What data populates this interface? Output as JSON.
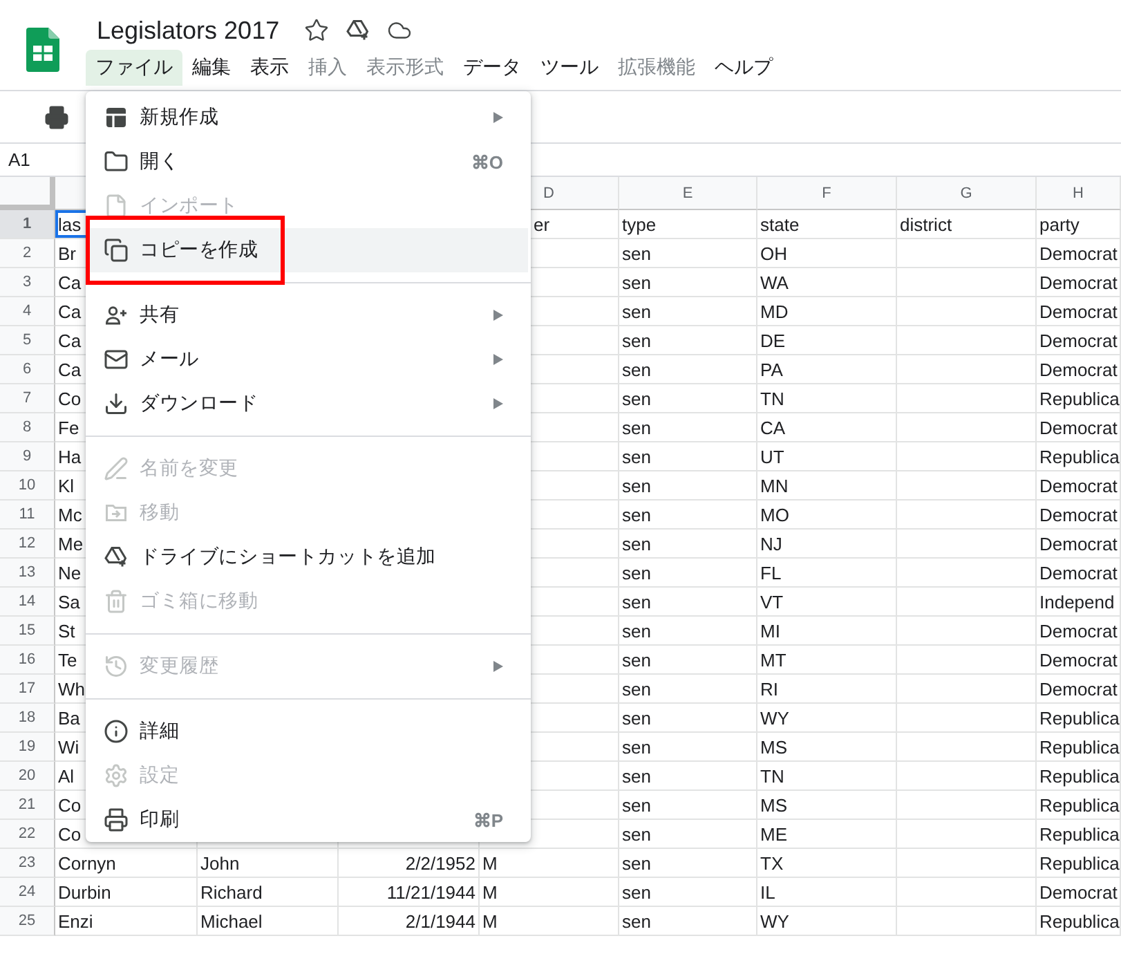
{
  "document": {
    "title": "Legislators 2017"
  },
  "menu_bar": [
    {
      "label": "ファイル",
      "selected": true,
      "disabled": false
    },
    {
      "label": "編集",
      "selected": false,
      "disabled": false
    },
    {
      "label": "表示",
      "selected": false,
      "disabled": false
    },
    {
      "label": "挿入",
      "selected": false,
      "disabled": true
    },
    {
      "label": "表示形式",
      "selected": false,
      "disabled": true
    },
    {
      "label": "データ",
      "selected": false,
      "disabled": false
    },
    {
      "label": "ツール",
      "selected": false,
      "disabled": false
    },
    {
      "label": "拡張機能",
      "selected": false,
      "disabled": true
    },
    {
      "label": "ヘルプ",
      "selected": false,
      "disabled": false
    }
  ],
  "name_box": "A1",
  "column_headers": [
    "D",
    "E",
    "F",
    "G",
    "H"
  ],
  "rows": [
    {
      "number": "1",
      "selected": true,
      "cells": {
        "a": "las",
        "d": "er",
        "e": "type",
        "f": "state",
        "g": "district",
        "h": "party"
      }
    },
    {
      "number": "2",
      "selected": false,
      "cells": {
        "a": "Br",
        "e": "sen",
        "f": "OH",
        "h": "Democrat"
      }
    },
    {
      "number": "3",
      "selected": false,
      "cells": {
        "a": "Ca",
        "e": "sen",
        "f": "WA",
        "h": "Democrat"
      }
    },
    {
      "number": "4",
      "selected": false,
      "cells": {
        "a": "Ca",
        "e": "sen",
        "f": "MD",
        "h": "Democrat"
      }
    },
    {
      "number": "5",
      "selected": false,
      "cells": {
        "a": "Ca",
        "e": "sen",
        "f": "DE",
        "h": "Democrat"
      }
    },
    {
      "number": "6",
      "selected": false,
      "cells": {
        "a": "Ca",
        "e": "sen",
        "f": "PA",
        "h": "Democrat"
      }
    },
    {
      "number": "7",
      "selected": false,
      "cells": {
        "a": "Co",
        "e": "sen",
        "f": "TN",
        "h": "Republica"
      }
    },
    {
      "number": "8",
      "selected": false,
      "cells": {
        "a": "Fe",
        "e": "sen",
        "f": "CA",
        "h": "Democrat"
      }
    },
    {
      "number": "9",
      "selected": false,
      "cells": {
        "a": "Ha",
        "e": "sen",
        "f": "UT",
        "h": "Republica"
      }
    },
    {
      "number": "10",
      "selected": false,
      "cells": {
        "a": "Kl",
        "e": "sen",
        "f": "MN",
        "h": "Democrat"
      }
    },
    {
      "number": "11",
      "selected": false,
      "cells": {
        "a": "Mc",
        "e": "sen",
        "f": "MO",
        "h": "Democrat"
      }
    },
    {
      "number": "12",
      "selected": false,
      "cells": {
        "a": "Me",
        "e": "sen",
        "f": "NJ",
        "h": "Democrat"
      }
    },
    {
      "number": "13",
      "selected": false,
      "cells": {
        "a": "Ne",
        "e": "sen",
        "f": "FL",
        "h": "Democrat"
      }
    },
    {
      "number": "14",
      "selected": false,
      "cells": {
        "a": "Sa",
        "e": "sen",
        "f": "VT",
        "h": "Independ"
      }
    },
    {
      "number": "15",
      "selected": false,
      "cells": {
        "a": "St",
        "e": "sen",
        "f": "MI",
        "h": "Democrat"
      }
    },
    {
      "number": "16",
      "selected": false,
      "cells": {
        "a": "Te",
        "e": "sen",
        "f": "MT",
        "h": "Democrat"
      }
    },
    {
      "number": "17",
      "selected": false,
      "cells": {
        "a": "Wh",
        "e": "sen",
        "f": "RI",
        "h": "Democrat"
      }
    },
    {
      "number": "18",
      "selected": false,
      "cells": {
        "a": "Ba",
        "e": "sen",
        "f": "WY",
        "h": "Republica"
      }
    },
    {
      "number": "19",
      "selected": false,
      "cells": {
        "a": "Wi",
        "e": "sen",
        "f": "MS",
        "h": "Republica"
      }
    },
    {
      "number": "20",
      "selected": false,
      "cells": {
        "a": "Al",
        "e": "sen",
        "f": "TN",
        "h": "Republica"
      }
    },
    {
      "number": "21",
      "selected": false,
      "cells": {
        "a": "Co",
        "e": "sen",
        "f": "MS",
        "h": "Republica"
      }
    },
    {
      "number": "22",
      "selected": false,
      "cells": {
        "a": "Co",
        "e": "sen",
        "f": "ME",
        "h": "Republica"
      }
    },
    {
      "number": "23",
      "selected": false,
      "cells": {
        "a": "Cornyn",
        "b": "John",
        "c": "2/2/1952",
        "d": "M",
        "e": "sen",
        "f": "TX",
        "h": "Republica"
      }
    },
    {
      "number": "24",
      "selected": false,
      "cells": {
        "a": "Durbin",
        "b": "Richard",
        "c": "11/21/1944",
        "d": "M",
        "e": "sen",
        "f": "IL",
        "h": "Democrat"
      }
    },
    {
      "number": "25",
      "selected": false,
      "cells": {
        "a": "Enzi",
        "b": "Michael",
        "c": "2/1/1944",
        "d": "M",
        "e": "sen",
        "f": "WY",
        "h": "Republica"
      }
    }
  ],
  "file_menu": [
    {
      "kind": "item",
      "label": "新規作成",
      "disabled": false,
      "submenu": true,
      "highlighted": false,
      "outlined": false
    },
    {
      "kind": "item",
      "label": "開く",
      "shortcut": "⌘O",
      "disabled": false,
      "submenu": false,
      "highlighted": false,
      "outlined": false
    },
    {
      "kind": "item",
      "label": "インポート",
      "disabled": true,
      "submenu": false,
      "highlighted": false,
      "outlined": false
    },
    {
      "kind": "item",
      "label": "コピーを作成",
      "disabled": false,
      "submenu": false,
      "highlighted": true,
      "outlined": true
    },
    {
      "kind": "divider"
    },
    {
      "kind": "item",
      "label": "共有",
      "disabled": false,
      "submenu": true,
      "highlighted": false,
      "outlined": false
    },
    {
      "kind": "item",
      "label": "メール",
      "disabled": false,
      "submenu": true,
      "highlighted": false,
      "outlined": false
    },
    {
      "kind": "item",
      "label": "ダウンロード",
      "disabled": false,
      "submenu": true,
      "highlighted": false,
      "outlined": false
    },
    {
      "kind": "divider"
    },
    {
      "kind": "item",
      "label": "名前を変更",
      "disabled": true,
      "submenu": false,
      "highlighted": false,
      "outlined": false
    },
    {
      "kind": "item",
      "label": "移動",
      "disabled": true,
      "submenu": false,
      "highlighted": false,
      "outlined": false
    },
    {
      "kind": "item",
      "label": "ドライブにショートカットを追加",
      "disabled": false,
      "submenu": false,
      "highlighted": false,
      "outlined": false
    },
    {
      "kind": "item",
      "label": "ゴミ箱に移動",
      "disabled": true,
      "submenu": false,
      "highlighted": false,
      "outlined": false
    },
    {
      "kind": "divider"
    },
    {
      "kind": "item",
      "label": "変更履歴",
      "disabled": true,
      "submenu": true,
      "highlighted": false,
      "outlined": false
    },
    {
      "kind": "divider"
    },
    {
      "kind": "item",
      "label": "詳細",
      "disabled": false,
      "submenu": false,
      "highlighted": false,
      "outlined": false
    },
    {
      "kind": "item",
      "label": "設定",
      "disabled": true,
      "submenu": false,
      "highlighted": false,
      "outlined": false
    },
    {
      "kind": "item",
      "label": "印刷",
      "shortcut": "⌘P",
      "disabled": false,
      "submenu": false,
      "highlighted": false,
      "outlined": false
    }
  ]
}
